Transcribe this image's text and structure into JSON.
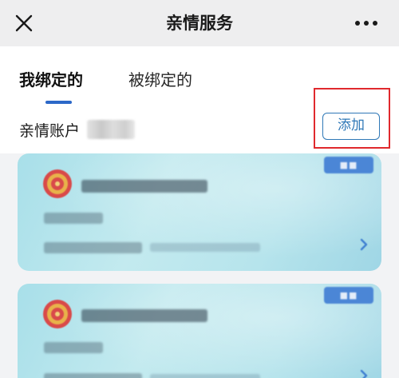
{
  "navbar": {
    "title": "亲情服务",
    "close_icon": "close-icon",
    "more_icon": "more-dots-icon"
  },
  "tabs": [
    {
      "label": "我绑定的",
      "active": true
    },
    {
      "label": "被绑定的",
      "active": false
    }
  ],
  "account": {
    "label": "亲情账户"
  },
  "add_button": {
    "label": "添加"
  },
  "colors": {
    "accent": "#2c68c8",
    "button_border": "#2f78b7",
    "highlight": "#e0292d",
    "card_gradient_start": "#a8dfe9",
    "card_gradient_end": "#9fd6e5"
  },
  "cards": [
    {
      "emblem_icon": "national-emblem-icon",
      "arrow_icon": "chevron-right-icon"
    },
    {
      "emblem_icon": "national-emblem-icon",
      "arrow_icon": "chevron-right-icon"
    }
  ]
}
